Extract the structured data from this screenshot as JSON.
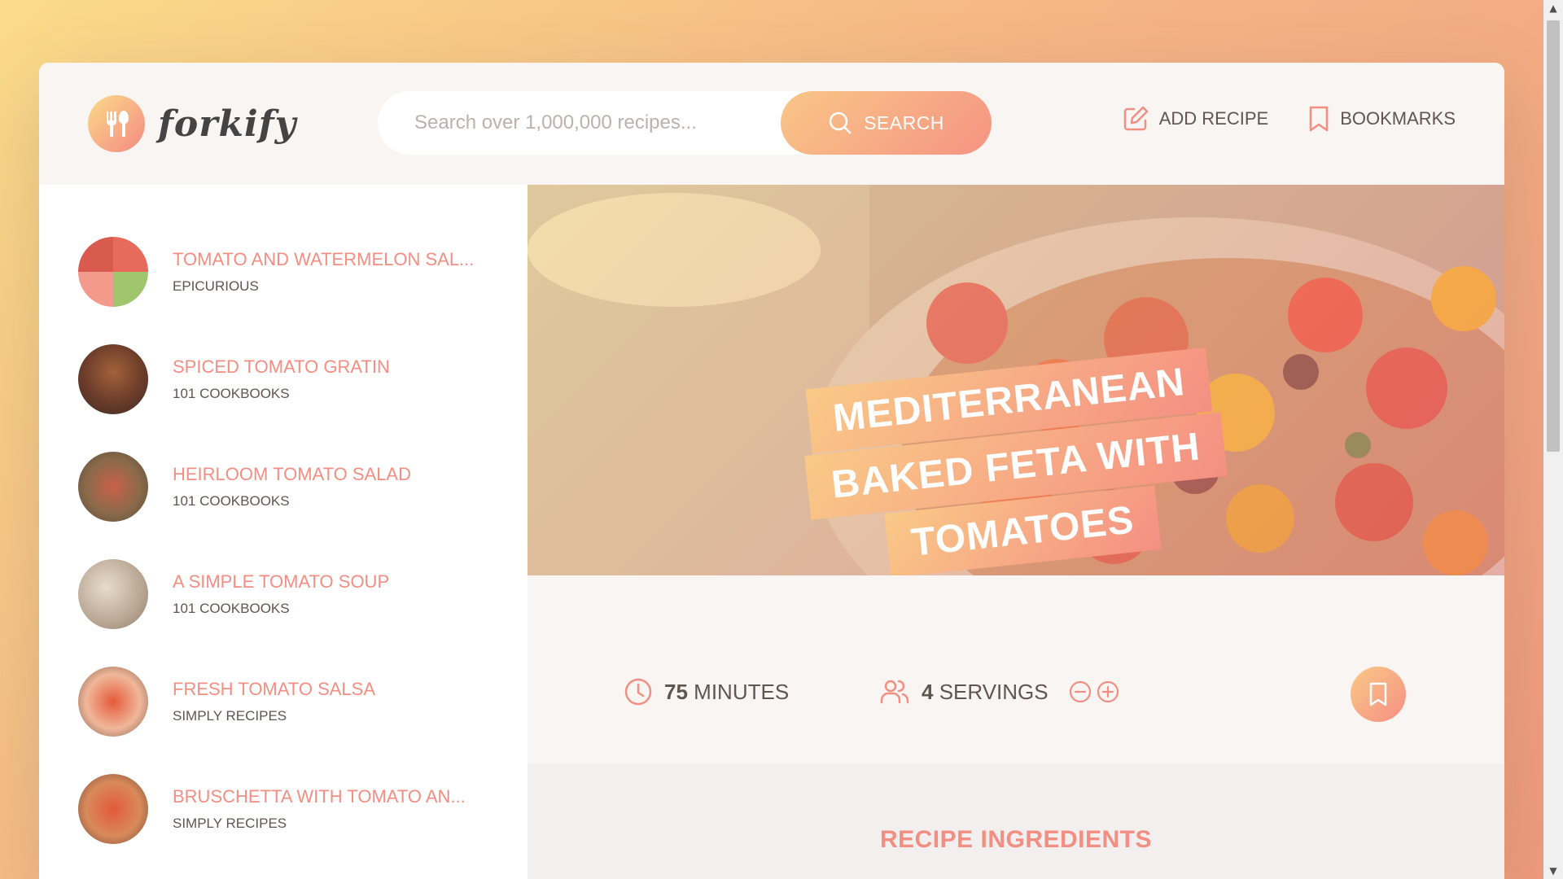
{
  "app": {
    "logo_text": "forkify"
  },
  "search": {
    "placeholder": "Search over 1,000,000 recipes...",
    "button_label": "SEARCH"
  },
  "nav": {
    "add_recipe": "ADD RECIPE",
    "bookmarks": "BOOKMARKS"
  },
  "results": [
    {
      "title": "TOMATO AND WATERMELON SAL...",
      "publisher": "EPICURIOUS"
    },
    {
      "title": "SPICED TOMATO GRATIN",
      "publisher": "101 COOKBOOKS"
    },
    {
      "title": "HEIRLOOM TOMATO SALAD",
      "publisher": "101 COOKBOOKS"
    },
    {
      "title": "A SIMPLE TOMATO SOUP",
      "publisher": "101 COOKBOOKS"
    },
    {
      "title": "FRESH TOMATO SALSA",
      "publisher": "SIMPLY RECIPES"
    },
    {
      "title": "BRUSCHETTA WITH TOMATO AN...",
      "publisher": "SIMPLY RECIPES"
    }
  ],
  "recipe": {
    "title_lines": [
      "MEDITERRANEAN",
      "BAKED FETA WITH",
      "TOMATOES"
    ],
    "minutes": "75",
    "minutes_label": "MINUTES",
    "servings": "4",
    "servings_label": "SERVINGS",
    "ingredients_heading": "RECIPE INGREDIENTS"
  },
  "colors": {
    "primary": "#f38e82",
    "grad_start": "#fbdb89",
    "grad_end": "#f48982",
    "text": "#615551"
  }
}
